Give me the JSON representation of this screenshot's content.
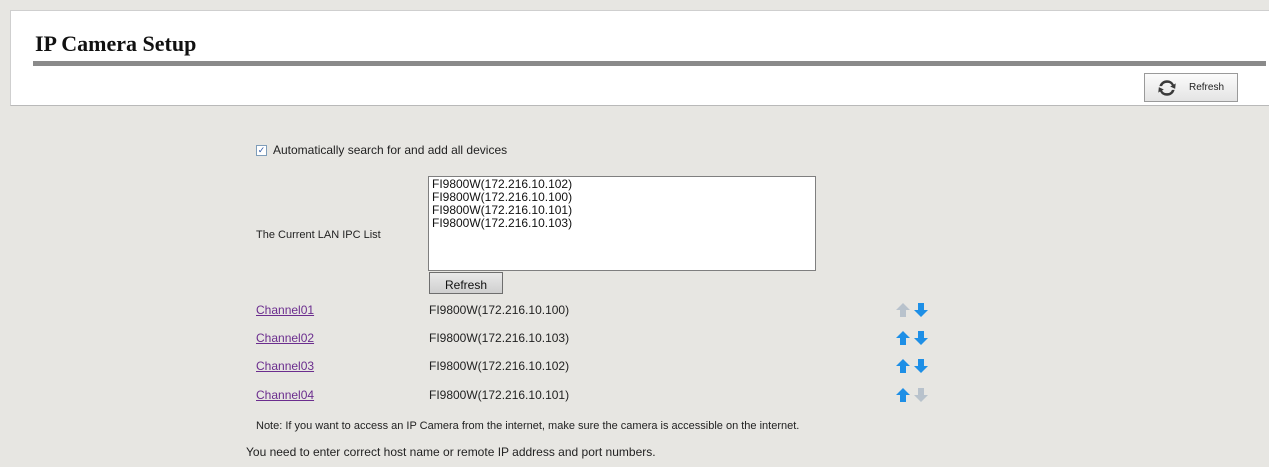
{
  "page": {
    "title": "IP Camera Setup",
    "top_refresh_label": "Refresh"
  },
  "auto_search": {
    "checked": true,
    "label": "Automatically search for and add all devices"
  },
  "ipc_list": {
    "label": "The Current LAN IPC List",
    "items": [
      "FI9800W(172.216.10.102)",
      "FI9800W(172.216.10.100)",
      "FI9800W(172.216.10.101)",
      "FI9800W(172.216.10.103)"
    ],
    "refresh_label": "Refresh"
  },
  "channels": [
    {
      "name": "Channel01",
      "device": "FI9800W(172.216.10.100)",
      "up_enabled": false,
      "down_enabled": true
    },
    {
      "name": "Channel02",
      "device": "FI9800W(172.216.10.103)",
      "up_enabled": true,
      "down_enabled": true
    },
    {
      "name": "Channel03",
      "device": "FI9800W(172.216.10.102)",
      "up_enabled": true,
      "down_enabled": true
    },
    {
      "name": "Channel04",
      "device": "FI9800W(172.216.10.101)",
      "up_enabled": true,
      "down_enabled": false
    }
  ],
  "notes": {
    "note1": "Note: If you want to access an IP Camera from the internet, make sure the camera is accessible on the internet.",
    "note2": "You need to enter correct host name or remote IP address and port numbers."
  },
  "colors": {
    "arrow_enabled": "#1e8fe6",
    "arrow_disabled": "#b8c2cc",
    "link": "#6b2d8e"
  },
  "icons": {
    "refresh": "refresh-icon",
    "up": "arrow-up-icon",
    "down": "arrow-down-icon",
    "check": "checkmark-icon"
  }
}
